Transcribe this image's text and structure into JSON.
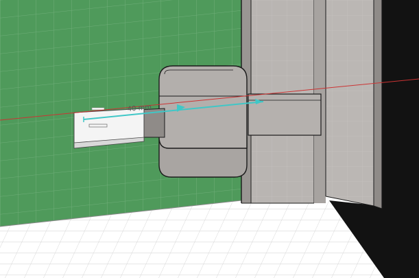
{
  "viewport": {
    "dimension_label": "40 mm",
    "colors": {
      "wall_green": "#4f9a5b",
      "wall_green_dark": "#3f8a4c",
      "floor_white": "#ffffff",
      "grid_line": "#d5d5d5",
      "steel_light": "#b9b5b2",
      "steel_mid": "#aaa6a3",
      "steel_dark": "#8f8b88",
      "hinge_face": "#a9a5a2",
      "edge_black": "#1a1a1a",
      "axis_red": "#cc3333",
      "axis_cyan": "#3fc7c7",
      "shadow_black": "#121212"
    },
    "icons": {
      "x_axis": "red-axis-line",
      "dimension": "cyan-dimension-arrow"
    }
  }
}
